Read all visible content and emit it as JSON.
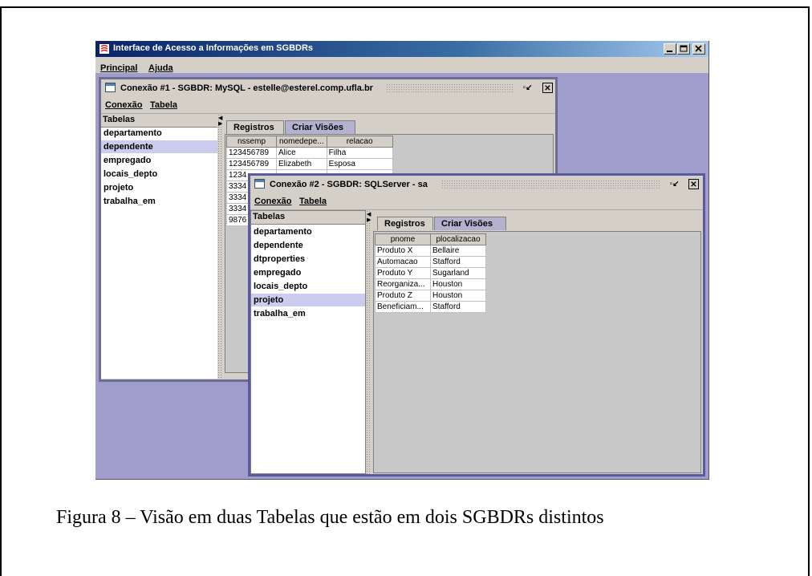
{
  "app": {
    "title": "Interface de Acesso a Informações em SGBDRs",
    "menu": [
      "Principal",
      "Ajuda"
    ],
    "window_buttons": [
      "minimize",
      "maximize",
      "close"
    ]
  },
  "conn1": {
    "title": "Conexão #1 - SGBDR: MySQL - estelle@esterel.comp.ufla.br",
    "menu": [
      "Conexão",
      "Tabela"
    ],
    "tables_header": "Tabelas",
    "tables": [
      "departamento",
      "dependente",
      "empregado",
      "locais_depto",
      "projeto",
      "trabalha_em"
    ],
    "selected_table": "dependente",
    "tabs": [
      "Registros",
      "Criar Visões"
    ],
    "grid": {
      "columns": [
        "nssemp",
        "nomedepe...",
        "relacao"
      ],
      "rows": [
        [
          "123456789",
          "Alice",
          "Filha"
        ],
        [
          "123456789",
          "Elizabeth",
          "Esposa"
        ]
      ],
      "partial_rows": [
        "1234",
        "3334",
        "3334",
        "3334",
        "9876"
      ]
    }
  },
  "conn2": {
    "title": "Conexão #2 - SGBDR: SQLServer - sa",
    "menu": [
      "Conexão",
      "Tabela"
    ],
    "tables_header": "Tabelas",
    "tables": [
      "departamento",
      "dependente",
      "dtproperties",
      "empregado",
      "locais_depto",
      "projeto",
      "trabalha_em"
    ],
    "selected_table": "projeto",
    "tabs": [
      "Registros",
      "Criar Visões"
    ],
    "grid": {
      "columns": [
        "pnome",
        "plocalizacao"
      ],
      "rows": [
        [
          "Produto X",
          "Bellaire"
        ],
        [
          "Automacao",
          "Stafford"
        ],
        [
          "Produto Y",
          "Sugarland"
        ],
        [
          "Reorganiza...",
          "Houston"
        ],
        [
          "Produto Z",
          "Houston"
        ],
        [
          "Beneficiam...",
          "Stafford"
        ]
      ]
    }
  },
  "caption": "Figura 8 – Visão em duas Tabelas que estão em dois SGBDRs distintos",
  "colors": {
    "desktop": "#a09ccc",
    "title_gradient_start": "#0a246a",
    "panel": "#d4d0c8",
    "selected": "#ccccee"
  }
}
